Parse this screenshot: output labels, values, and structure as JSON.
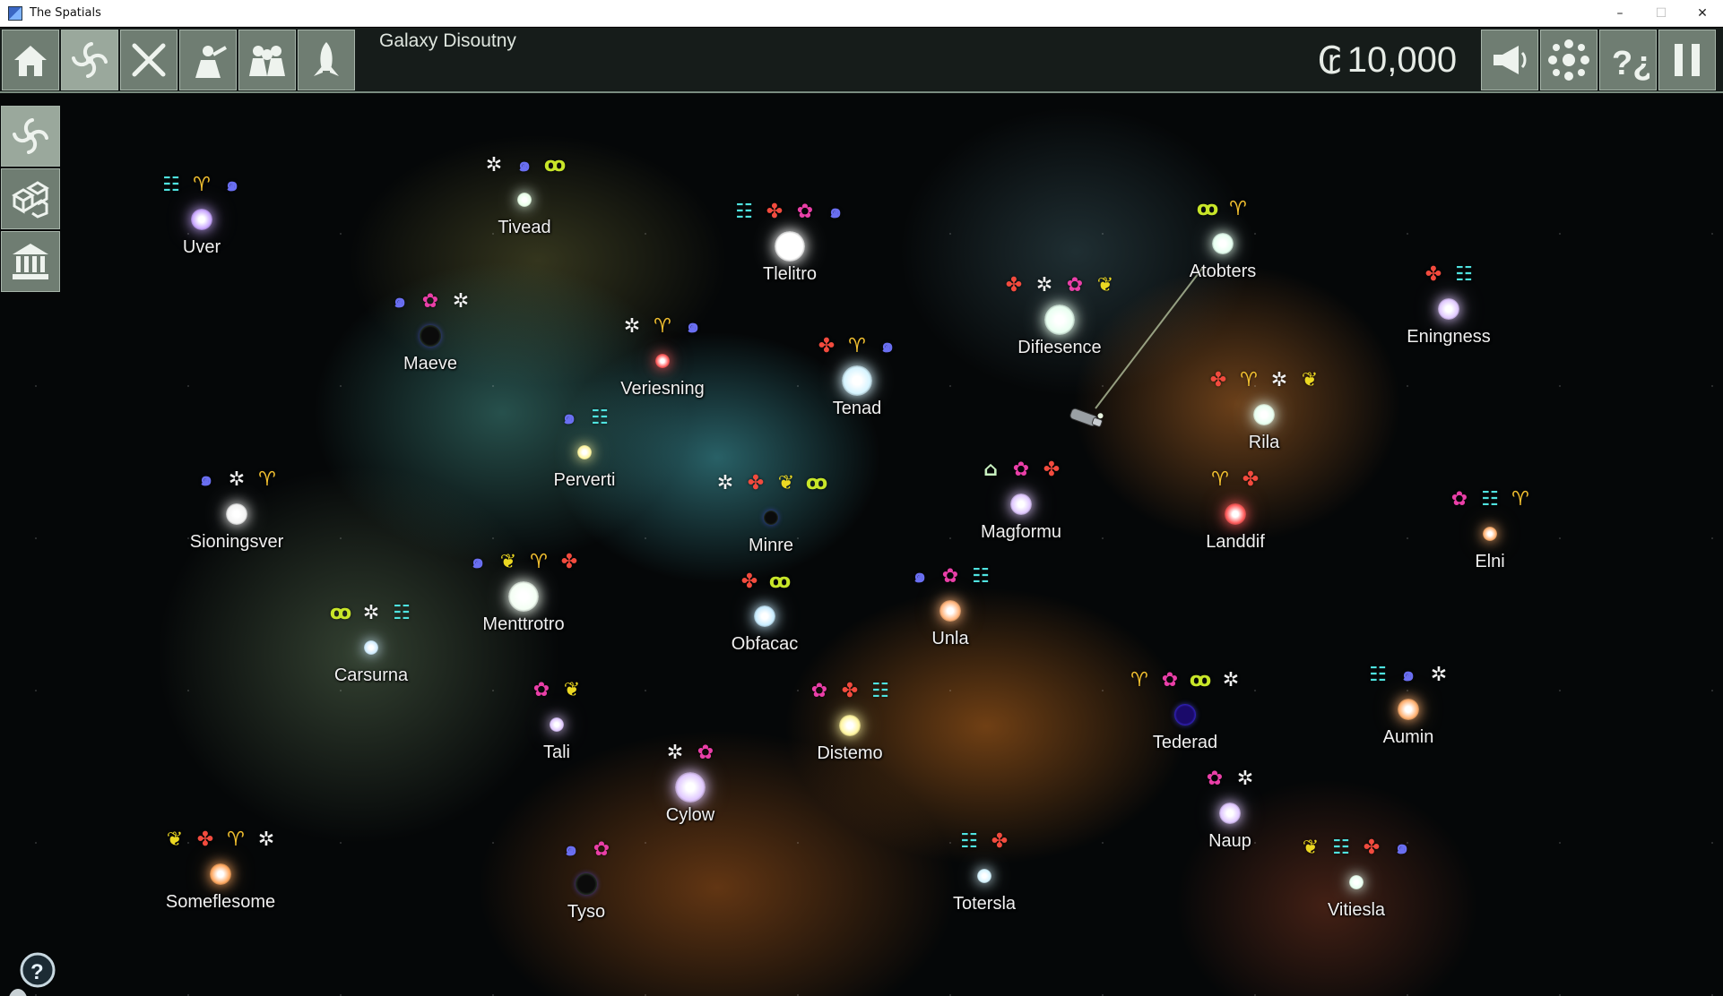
{
  "window": {
    "title": "The Spatials",
    "minimize_glyph": "–",
    "maximize_glyph": "☐",
    "close_glyph": "✕"
  },
  "toolbar": {
    "left_buttons": [
      {
        "icon": "home-icon",
        "active": false
      },
      {
        "icon": "galaxy-icon",
        "active": true
      },
      {
        "icon": "crossed-swords-icon",
        "active": false
      },
      {
        "icon": "trade-icon",
        "active": false
      },
      {
        "icon": "crew-icon",
        "active": false
      },
      {
        "icon": "rocket-icon",
        "active": false
      }
    ],
    "galaxy_name": "Galaxy Disoutny",
    "credits_symbol": "₢",
    "credits": "10,000",
    "right_buttons": [
      "megaphone-icon",
      "network-icon",
      "help-icon",
      "pause-icon"
    ]
  },
  "sidebar": {
    "buttons": [
      {
        "icon": "galaxy-icon",
        "active": true
      },
      {
        "icon": "cubes-icon",
        "active": false
      },
      {
        "icon": "bank-icon",
        "active": false
      }
    ]
  },
  "resource_types": {
    "cargo": {
      "glyph": "☷",
      "color": "#4fe3e0"
    },
    "horns": {
      "glyph": "♈",
      "color": "#f2c030"
    },
    "spiral": {
      "glyph": "๑",
      "color": "#6a6ff2"
    },
    "star": {
      "glyph": "✲",
      "color": "#f2f2f2"
    },
    "lion": {
      "glyph": "ꝏ",
      "color": "#c8e629"
    },
    "sprout": {
      "glyph": "✤",
      "color": "#f24b3e"
    },
    "flower": {
      "glyph": "✿",
      "color": "#ea3fa8"
    },
    "bug": {
      "glyph": "❦",
      "color": "#ecd822"
    },
    "house": {
      "glyph": "⌂",
      "color": "#c8f0c0"
    }
  },
  "systems": [
    {
      "name": "Uver",
      "planet_color": "#c9a7ff",
      "size": "mid",
      "resources": [
        "cargo",
        "horns",
        "spiral"
      ]
    },
    {
      "name": "Tivead",
      "planet_color": "#e8ffe8",
      "size": "small",
      "resources": [
        "star",
        "spiral",
        "lion"
      ]
    },
    {
      "name": "Tlelitro",
      "planet_color": "#ffffff",
      "size": "big",
      "resources": [
        "cargo",
        "sprout",
        "flower",
        "spiral"
      ]
    },
    {
      "name": "Atobters",
      "planet_color": "#e6fff0",
      "size": "mid",
      "resources": [
        "lion",
        "horns"
      ]
    },
    {
      "name": "Eningness",
      "planet_color": "#e0c8ff",
      "size": "mid",
      "resources": [
        "sprout",
        "cargo"
      ]
    },
    {
      "name": "Maeve",
      "planet_color": "#0b0b0b",
      "size": "mid",
      "resources": [
        "spiral",
        "flower",
        "star"
      ]
    },
    {
      "name": "Veriesning",
      "planet_color": "#ff5a5a",
      "size": "small",
      "resources": [
        "star",
        "horns",
        "spiral"
      ]
    },
    {
      "name": "Tenad",
      "planet_color": "#d6f4ff",
      "size": "big",
      "resources": [
        "sprout",
        "horns",
        "spiral"
      ]
    },
    {
      "name": "Difiesence",
      "planet_color": "#e8fff0",
      "size": "big",
      "resources": [
        "sprout",
        "star",
        "flower",
        "bug"
      ]
    },
    {
      "name": "Rila",
      "planet_color": "#e8fff0",
      "size": "mid",
      "resources": [
        "sprout",
        "horns",
        "star",
        "bug"
      ]
    },
    {
      "name": "Perverti",
      "planet_color": "#fff6a0",
      "size": "small",
      "resources": [
        "spiral",
        "cargo"
      ]
    },
    {
      "name": "Sioningsver",
      "planet_color": "#f2f2f2",
      "size": "mid",
      "resources": [
        "spiral",
        "star",
        "horns"
      ]
    },
    {
      "name": "Minre",
      "planet_color": "#0b0b0b",
      "size": "small",
      "resources": [
        "star",
        "sprout",
        "bug",
        "lion"
      ]
    },
    {
      "name": "Magformu",
      "planet_color": "#e0c8ff",
      "size": "mid",
      "resources": [
        "house",
        "flower",
        "sprout"
      ]
    },
    {
      "name": "Landdif",
      "planet_color": "#ff5a5a",
      "size": "mid",
      "resources": [
        "horns",
        "sprout"
      ]
    },
    {
      "name": "Elni",
      "planet_color": "#ffb070",
      "size": "small",
      "resources": [
        "flower",
        "cargo",
        "horns"
      ]
    },
    {
      "name": "Menttrotro",
      "planet_color": "#f4fff4",
      "size": "big",
      "resources": [
        "spiral",
        "bug",
        "horns",
        "sprout"
      ]
    },
    {
      "name": "Carsurna",
      "planet_color": "#d0ecff",
      "size": "small",
      "resources": [
        "lion",
        "star",
        "cargo"
      ]
    },
    {
      "name": "Obfacac",
      "planet_color": "#c8ecff",
      "size": "mid",
      "resources": [
        "sprout",
        "lion"
      ]
    },
    {
      "name": "Unla",
      "planet_color": "#ffb37a",
      "size": "mid",
      "resources": [
        "spiral",
        "flower",
        "cargo"
      ]
    },
    {
      "name": "Tali",
      "planet_color": "#e0c8ff",
      "size": "small",
      "resources": [
        "flower",
        "bug"
      ]
    },
    {
      "name": "Distemo",
      "planet_color": "#fff6a0",
      "size": "mid",
      "resources": [
        "flower",
        "sprout",
        "cargo"
      ]
    },
    {
      "name": "Tederad",
      "planet_color": "#1a0a6a",
      "size": "mid",
      "resources": [
        "horns",
        "flower",
        "lion",
        "star"
      ]
    },
    {
      "name": "Aumin",
      "planet_color": "#ffb070",
      "size": "mid",
      "resources": [
        "cargo",
        "spiral",
        "star"
      ]
    },
    {
      "name": "Cylow",
      "planet_color": "#e0c8ff",
      "size": "big",
      "resources": [
        "star",
        "flower"
      ]
    },
    {
      "name": "Naup",
      "planet_color": "#e0c8ff",
      "size": "mid",
      "resources": [
        "flower",
        "star"
      ]
    },
    {
      "name": "Someflesome",
      "planet_color": "#ffa860",
      "size": "mid",
      "resources": [
        "bug",
        "sprout",
        "horns",
        "star"
      ]
    },
    {
      "name": "Tyso",
      "planet_color": "#0b0b0b",
      "size": "mid",
      "resources": [
        "spiral",
        "flower"
      ]
    },
    {
      "name": "Totersla",
      "planet_color": "#d6f4ff",
      "size": "small",
      "resources": [
        "cargo",
        "sprout"
      ]
    },
    {
      "name": "Vitiesla",
      "planet_color": "#e8fff0",
      "size": "small",
      "resources": [
        "bug",
        "cargo",
        "sprout",
        "spiral"
      ]
    }
  ]
}
